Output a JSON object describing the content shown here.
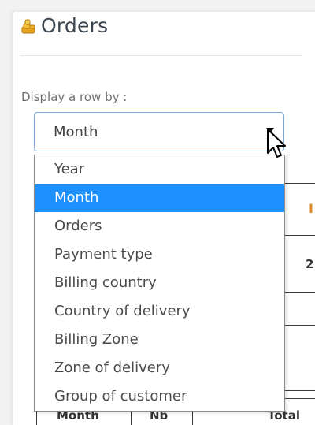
{
  "header": {
    "title": "Orders",
    "icon": "coins-icon"
  },
  "filter": {
    "label": "Display a row by :",
    "selected": "Month",
    "options": [
      "Year",
      "Month",
      "Orders",
      "Payment type",
      "Billing country",
      "Country of delivery",
      "Billing Zone",
      "Zone of delivery",
      "Group of customer"
    ]
  },
  "background_table": {
    "col_month": "Month",
    "col_nb": "Nb",
    "col_total": "Total",
    "orange_fragment": "I",
    "value_fragment": "2"
  },
  "colors": {
    "selection": "#1e90ff",
    "select_border": "#7aa7d6",
    "accent_orange": "#d98a2c"
  }
}
